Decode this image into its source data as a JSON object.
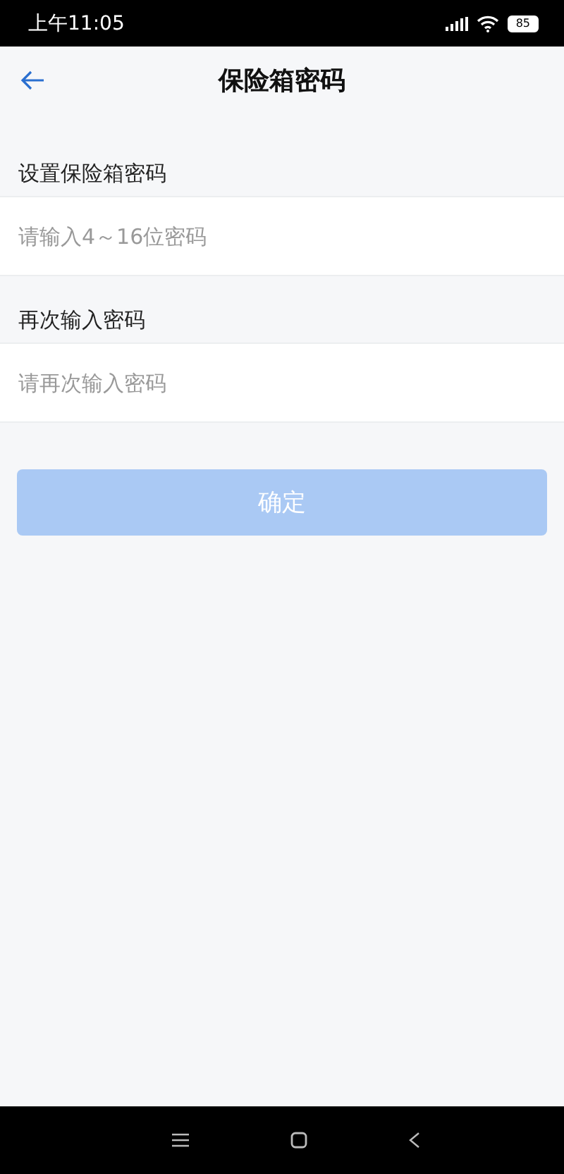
{
  "status_bar": {
    "time": "上午11:05",
    "battery": "85"
  },
  "header": {
    "title": "保险箱密码"
  },
  "fields": [
    {
      "label": "设置保险箱密码",
      "placeholder": "请输入4～16位密码"
    },
    {
      "label": "再次输入密码",
      "placeholder": "请再次输入密码"
    }
  ],
  "confirm_button": {
    "label": "确定",
    "disabled": true
  }
}
